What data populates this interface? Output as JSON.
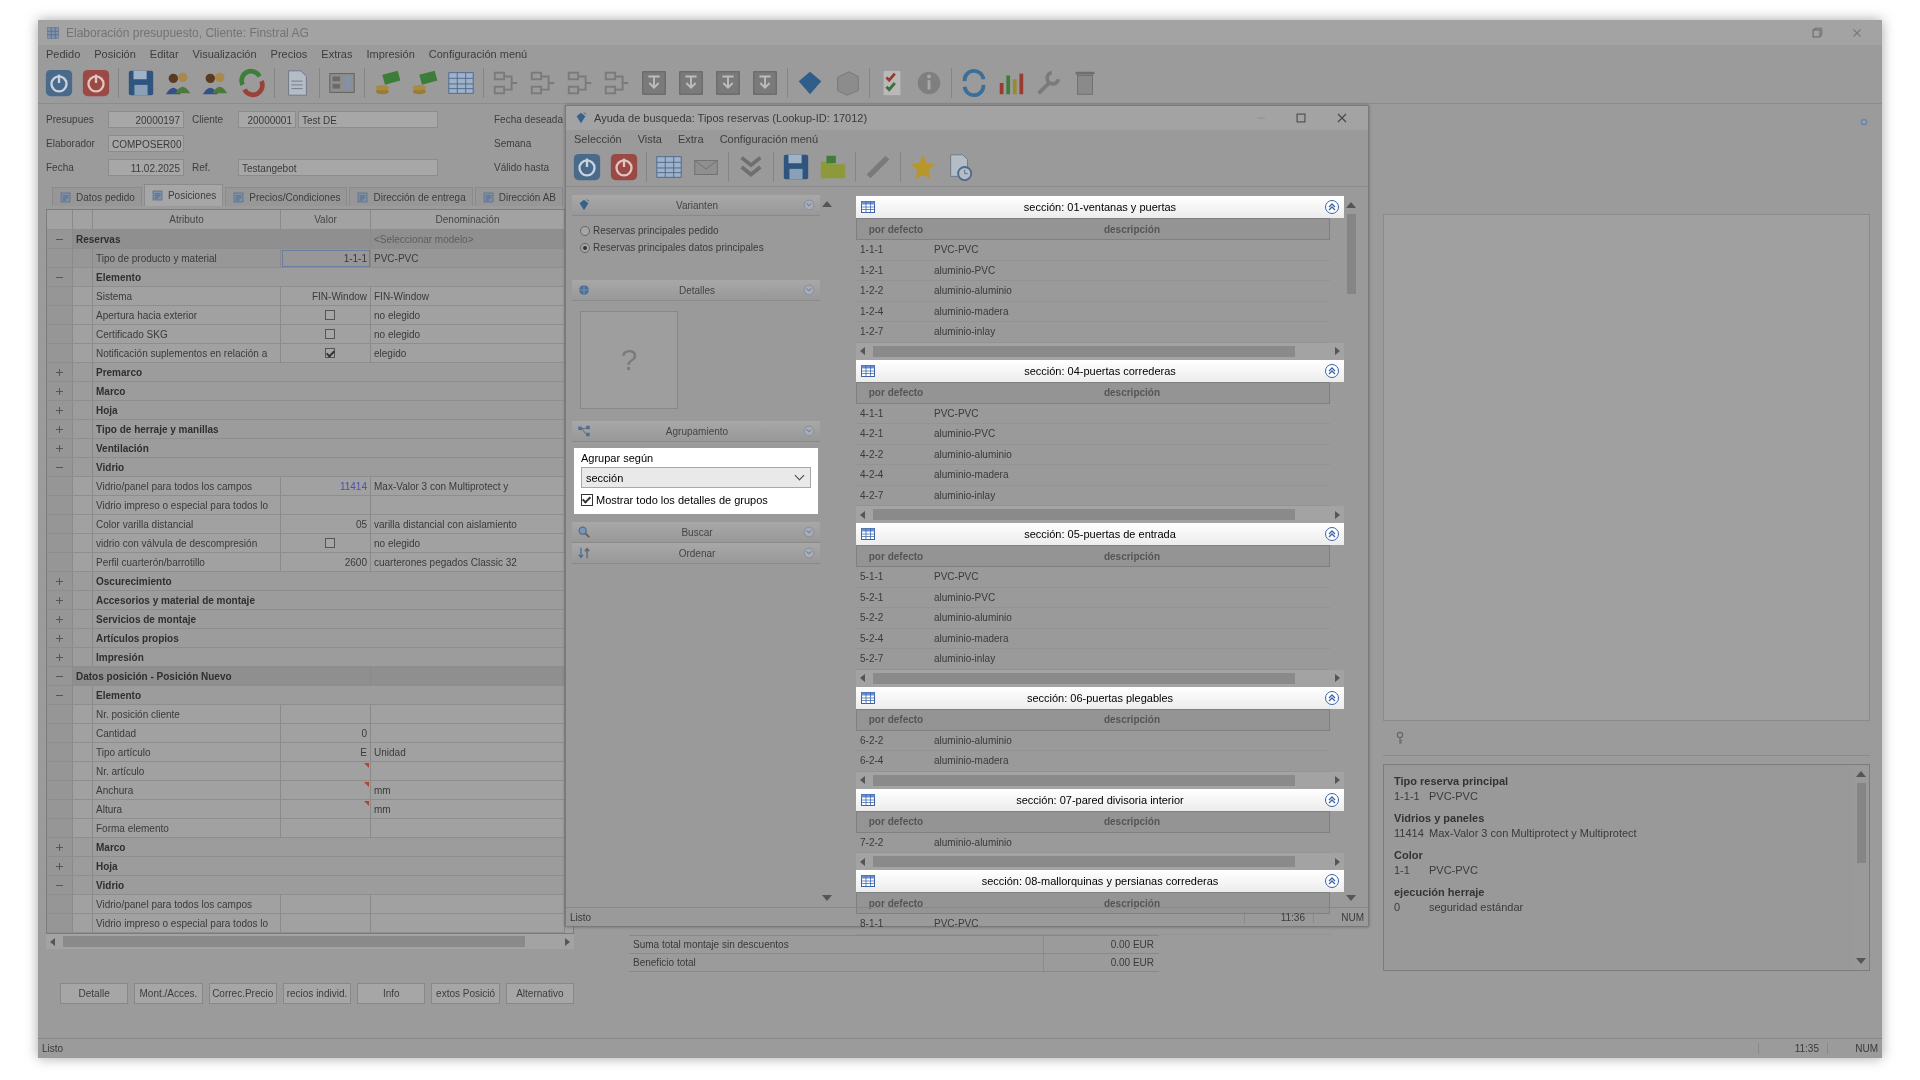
{
  "window": {
    "title": "Elaboración presupuesto, Cliente: Finstral AG"
  },
  "menu": [
    "Pedido",
    "Posición",
    "Editar",
    "Visualización",
    "Precios",
    "Extras",
    "Impresión",
    "Configuración menú"
  ],
  "header": [
    {
      "label": "Presupues",
      "value": "20000197",
      "label2": "Cliente",
      "value2": "20000001",
      "value3": "Test DE",
      "label3": "Fecha deseada"
    },
    {
      "label": "Elaborador",
      "value": "COMPOSER00",
      "label3": "Semana"
    },
    {
      "label": "Fecha",
      "value": "11.02.2025",
      "label2": "Ref.",
      "value2": "Testangebot",
      "label3": "Válido hasta"
    }
  ],
  "tabs": [
    {
      "label": "Datos pedido",
      "selected": false
    },
    {
      "label": "Posiciones",
      "selected": true
    },
    {
      "label": "Precios/Condiciones",
      "selected": false
    },
    {
      "label": "Dirección de entrega",
      "selected": false
    },
    {
      "label": "Dirección AB",
      "selected": false
    }
  ],
  "table": {
    "columns": [
      "Atributo",
      "Valor",
      "Denominación"
    ],
    "rows": [
      {
        "kind": "section",
        "label": "Reservas",
        "expanded": true,
        "placeholder": "<Seleccionar modelo>",
        "children": [
          {
            "kind": "attr",
            "label": "Tipo de producto y material",
            "value": {
              "kind": "text",
              "text": "1-1-1"
            },
            "denomination": "PVC-PVC",
            "selected": true
          },
          {
            "kind": "group",
            "label": "Elemento",
            "expanded": true,
            "children": [
              {
                "kind": "attr",
                "label": "Sistema",
                "value": {
                  "kind": "text",
                  "text": "FIN-Window"
                },
                "denomination": "FIN-Window",
                "selected": false
              },
              {
                "kind": "attr",
                "label": "Apertura hacia exterior",
                "value": {
                  "kind": "checkbox",
                  "checked": false
                },
                "denomination": "no elegido",
                "selected": false
              },
              {
                "kind": "attr",
                "label": "Certificado SKG",
                "value": {
                  "kind": "checkbox",
                  "checked": false
                },
                "denomination": "no elegido",
                "selected": false
              },
              {
                "kind": "attr",
                "label": "Notificación suplementos en relación a",
                "value": {
                  "kind": "checkbox",
                  "checked": true
                },
                "denomination": "elegido",
                "selected": false
              }
            ]
          },
          {
            "kind": "group",
            "label": "Premarco",
            "expanded": false
          },
          {
            "kind": "group",
            "label": "Marco",
            "expanded": false
          },
          {
            "kind": "group",
            "label": "Hoja",
            "expanded": false
          },
          {
            "kind": "group",
            "label": "Tipo de herraje y manillas",
            "expanded": false
          },
          {
            "kind": "group",
            "label": "Ventilación",
            "expanded": false
          },
          {
            "kind": "group",
            "label": "Vidrio",
            "expanded": true,
            "children": [
              {
                "kind": "attr",
                "label": "Vidrio/panel para todos los campos",
                "value": {
                  "kind": "link",
                  "text": "11414"
                },
                "denomination": "Max-Valor 3 con Multiprotect y",
                "selected": false
              },
              {
                "kind": "attr",
                "label": "Vidrio impreso o especial para todos lo",
                "selected": false
              },
              {
                "kind": "attr",
                "label": "Color varilla distancial",
                "value": {
                  "kind": "text",
                  "text": "05"
                },
                "denomination": "varilla distancial con aislamiento",
                "selected": false
              },
              {
                "kind": "attr",
                "label": "vidrio con válvula de descompresión",
                "value": {
                  "kind": "checkbox",
                  "checked": false
                },
                "denomination": "no elegido",
                "selected": false
              },
              {
                "kind": "attr",
                "label": "Perfil cuarterón/barrotillo",
                "value": {
                  "kind": "text",
                  "text": "2600"
                },
                "denomination": "cuarterones pegados Classic 32",
                "selected": false
              }
            ]
          },
          {
            "kind": "group",
            "label": "Oscurecimiento",
            "expanded": false
          },
          {
            "kind": "group",
            "label": "Accesorios y material de montaje",
            "expanded": false
          },
          {
            "kind": "group",
            "label": "Servicios de montaje",
            "expanded": false
          },
          {
            "kind": "group",
            "label": "Artículos propios",
            "expanded": false
          },
          {
            "kind": "group",
            "label": "Impresión",
            "expanded": false
          }
        ]
      },
      {
        "kind": "section",
        "label": "Datos posición - Posición Nuevo",
        "expanded": true,
        "children": [
          {
            "kind": "group",
            "label": "Elemento",
            "expanded": true,
            "children": [
              {
                "kind": "attr",
                "label": "Nr. posición cliente",
                "selected": false
              },
              {
                "kind": "attr",
                "label": "Cantidad",
                "value": {
                  "kind": "text",
                  "text": "0"
                },
                "selected": false
              },
              {
                "kind": "attr",
                "label": "Tipo artículo",
                "value": {
                  "kind": "text",
                  "text": "E"
                },
                "denomination": "Unidad",
                "selected": false
              },
              {
                "kind": "attr",
                "label": "Nr. artículo",
                "required": true,
                "selected": false
              },
              {
                "kind": "attr",
                "label": "Anchura",
                "required": true,
                "denomination": "mm",
                "selected": false
              },
              {
                "kind": "attr",
                "label": "Altura",
                "required": true,
                "denomination": "mm",
                "selected": false
              },
              {
                "kind": "attr",
                "label": "Forma elemento",
                "selected": false
              }
            ]
          },
          {
            "kind": "group",
            "label": "Marco",
            "expanded": false
          },
          {
            "kind": "group",
            "label": "Hoja",
            "expanded": false
          },
          {
            "kind": "group",
            "label": "Vidrio",
            "expanded": true,
            "children": [
              {
                "kind": "attr",
                "label": "Vidrio/panel para todos los campos",
                "selected": false
              },
              {
                "kind": "attr",
                "label": "Vidrio impreso o especial para todos lo",
                "selected": false
              }
            ]
          }
        ]
      }
    ]
  },
  "buttons": [
    "Detalle",
    "Mont./Acces.",
    "Correc.Precio",
    "recios individ.",
    "Info",
    "extos Posició",
    "Alternativo"
  ],
  "summary": [
    {
      "label": "Suma total montaje sin descuentos",
      "value": "0.00 EUR"
    },
    {
      "label": "Beneficio total",
      "value": "0.00 EUR"
    }
  ],
  "info": [
    {
      "title": "Tipo reserva principal",
      "code": "1-1-1",
      "text": "PVC-PVC"
    },
    {
      "title": "Vidrios y paneles",
      "code": "11414",
      "text": "Max-Valor 3 con Multiprotect y Multiprotect"
    },
    {
      "title": "Color",
      "code": "1-1",
      "text": "PVC-PVC"
    },
    {
      "title": "ejecución herraje",
      "code": "0",
      "text": "seguridad estándar"
    }
  ],
  "status_bar": {
    "text": "Listo",
    "time": "11:35",
    "mode": "NUM"
  },
  "lookup": {
    "title": "Ayuda de busqueda: Tipos reservas (Lookup-ID: 17012)",
    "menu": [
      "Selección",
      "Vista",
      "Extra",
      "Configuración menú"
    ],
    "panels": [
      {
        "kind": "variants",
        "title": "Varianten",
        "options": [
          {
            "label": "Reservas principales pedido",
            "selected": false
          },
          {
            "label": "Reservas principales datos principales",
            "selected": true
          }
        ]
      },
      {
        "kind": "details",
        "title": "Detalles",
        "image_placeholder": "?"
      },
      {
        "kind": "grouping",
        "title": "Agrupamiento",
        "highlighted": true,
        "label": "Agrupar según",
        "value": "sección",
        "checkbox_label": "Mostrar todo los detalles de grupos",
        "checked": true
      },
      {
        "kind": "search",
        "title": "Buscar"
      },
      {
        "kind": "sort",
        "title": "Ordenar"
      }
    ],
    "groups": [
      {
        "title": "sección: 01-ventanas y puertas",
        "highlighted": true,
        "columns": [
          "por defecto",
          "descripción"
        ],
        "rows": [
          {
            "code": "1-1-1",
            "description": "PVC-PVC"
          },
          {
            "code": "1-2-1",
            "description": "aluminio-PVC"
          },
          {
            "code": "1-2-2",
            "description": "aluminio-aluminio"
          },
          {
            "code": "1-2-4",
            "description": "aluminio-madera"
          },
          {
            "code": "1-2-7",
            "description": "aluminio-inlay"
          }
        ]
      },
      {
        "title": "sección: 04-puertas correderas",
        "highlighted": true,
        "columns": [
          "por defecto",
          "descripción"
        ],
        "rows": [
          {
            "code": "4-1-1",
            "description": "PVC-PVC"
          },
          {
            "code": "4-2-1",
            "description": "aluminio-PVC"
          },
          {
            "code": "4-2-2",
            "description": "aluminio-aluminio"
          },
          {
            "code": "4-2-4",
            "description": "aluminio-madera"
          },
          {
            "code": "4-2-7",
            "description": "aluminio-inlay"
          }
        ]
      },
      {
        "title": "sección: 05-puertas de entrada",
        "highlighted": true,
        "columns": [
          "por defecto",
          "descripción"
        ],
        "rows": [
          {
            "code": "5-1-1",
            "description": "PVC-PVC"
          },
          {
            "code": "5-2-1",
            "description": "aluminio-PVC"
          },
          {
            "code": "5-2-2",
            "description": "aluminio-aluminio"
          },
          {
            "code": "5-2-4",
            "description": "aluminio-madera"
          },
          {
            "code": "5-2-7",
            "description": "aluminio-inlay"
          }
        ]
      },
      {
        "title": "sección: 06-puertas plegables",
        "highlighted": true,
        "columns": [
          "por defecto",
          "descripción"
        ],
        "rows": [
          {
            "code": "6-2-2",
            "description": "aluminio-aluminio"
          },
          {
            "code": "6-2-4",
            "description": "aluminio-madera"
          }
        ]
      },
      {
        "title": "sección: 07-pared divisoria interior",
        "highlighted": true,
        "columns": [
          "por defecto",
          "descripción"
        ],
        "rows": [
          {
            "code": "7-2-2",
            "description": "aluminio-aluminio"
          }
        ]
      },
      {
        "title": "sección: 08-mallorquinas y persianas correderas",
        "highlighted": true,
        "columns": [
          "por defecto",
          "descripción"
        ],
        "rows": [
          {
            "code": "8-1-1",
            "description": "PVC-PVC"
          }
        ]
      }
    ],
    "status": {
      "text": "Listo",
      "time": "11:36",
      "mode": "NUM"
    }
  }
}
